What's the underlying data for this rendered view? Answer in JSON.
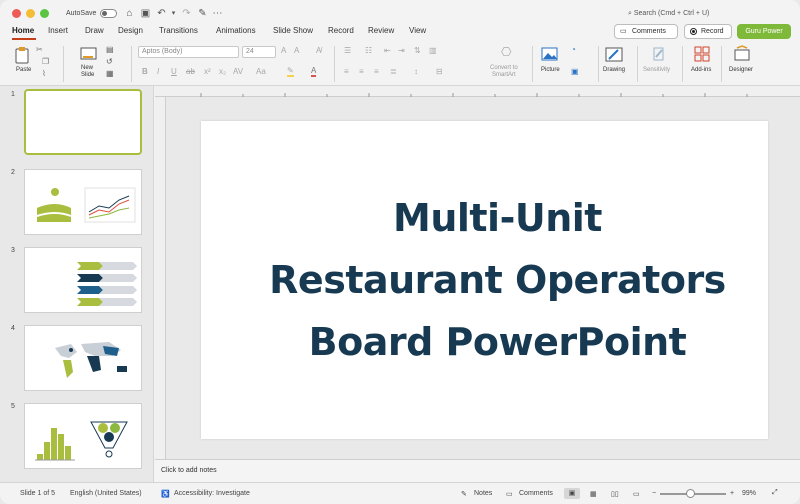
{
  "titlebar": {
    "autosave_label": "AutoSave",
    "search_placeholder": "Search (Cmd + Ctrl + U)"
  },
  "tabs": [
    "Home",
    "Insert",
    "Draw",
    "Design",
    "Transitions",
    "Animations",
    "Slide Show",
    "Record",
    "Review",
    "View"
  ],
  "actions": {
    "comments_label": "Comments",
    "record_label": "Record",
    "guru_label": "Guru Power"
  },
  "ribbon": {
    "paste_label": "Paste",
    "new_slide_label_1": "New",
    "new_slide_label_2": "Slide",
    "font_name": "Aptos (Body)",
    "font_size": "24",
    "convert_label_1": "Convert to",
    "convert_label_2": "SmartArt",
    "picture_label": "Picture",
    "drawing_label": "Drawing",
    "sensitivity_label": "Sensitivity",
    "addins_label": "Add-ins",
    "designer_label": "Designer"
  },
  "thumbnails": [
    "1",
    "2",
    "3",
    "4",
    "5"
  ],
  "slide": {
    "title_line1": "Multi-Unit",
    "title_line2": "Restaurant Operators",
    "title_line3": "Board PowerPoint"
  },
  "notes_placeholder": "Click to add notes",
  "status": {
    "slide_counter": "Slide 1 of 5",
    "language": "English (United States)",
    "accessibility": "Accessibility: Investigate",
    "notes_label": "Notes",
    "comments_label": "Comments",
    "zoom": "99%"
  },
  "colors": {
    "accent_green": "#7fb93a",
    "title_navy": "#173a52",
    "tab_underline": "#c43e1c"
  }
}
